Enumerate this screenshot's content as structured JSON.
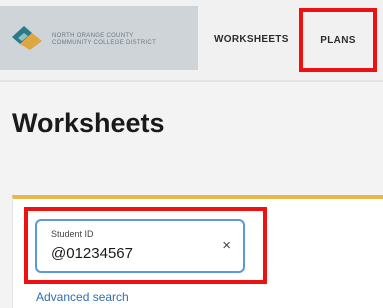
{
  "header": {
    "logo_text_line1": "NORTH ORANGE COUNTY",
    "logo_text_line2": "COMMUNITY COLLEGE DISTRICT",
    "nav": {
      "worksheets_label": "WORKSHEETS",
      "plans_label": "PLANS"
    }
  },
  "main": {
    "title": "Worksheets",
    "search": {
      "field_label": "Student ID",
      "field_value": "@01234567",
      "clear_glyph": "×",
      "advanced_search_label": "Advanced search"
    }
  },
  "colors": {
    "highlight": "#ee1111",
    "card_top_border": "#e9b84a",
    "input_border": "#5b9bd5",
    "link": "#2f6fb0"
  },
  "icons": {
    "logo": "nocccd-logo-icon",
    "clear": "close-icon"
  }
}
